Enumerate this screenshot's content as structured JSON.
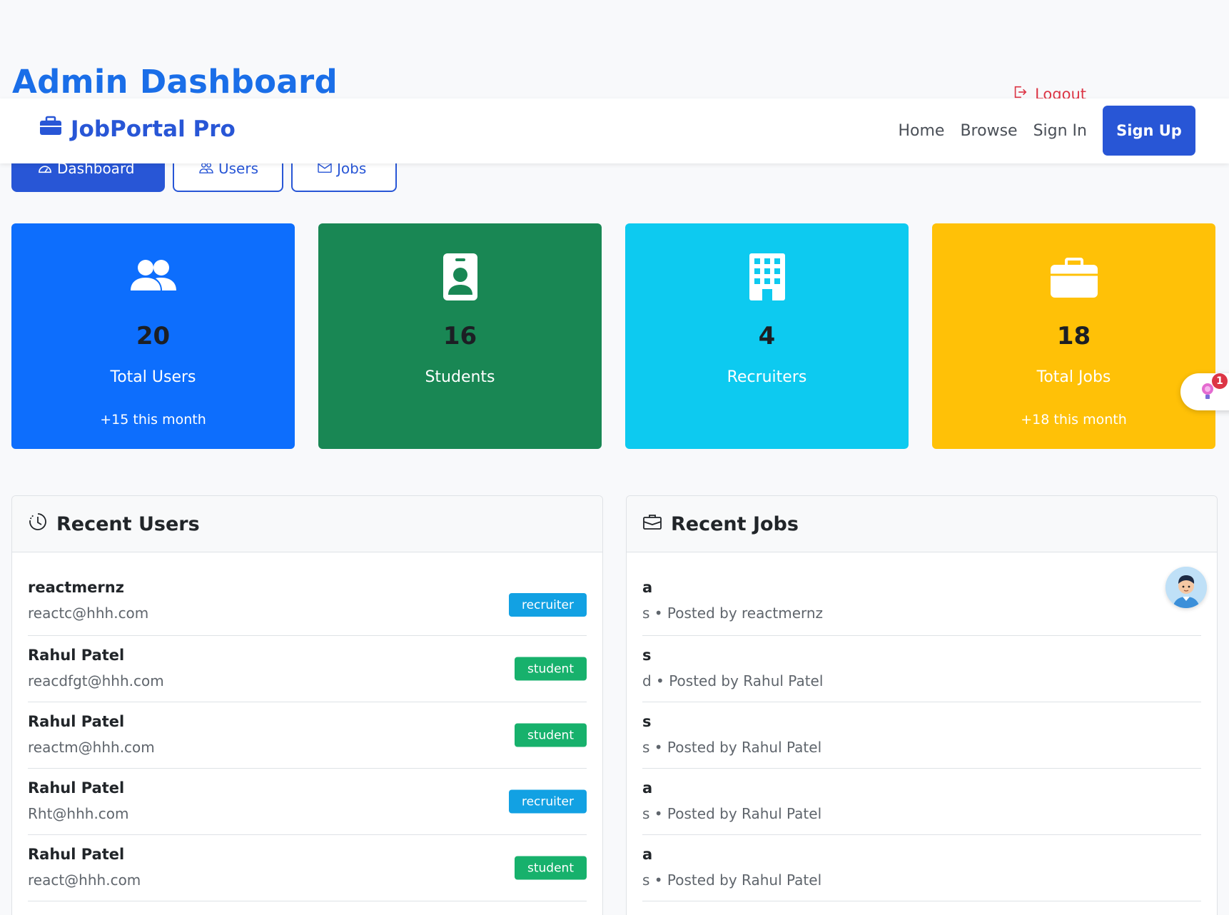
{
  "page": {
    "title": "Admin Dashboard",
    "logout_label": "Logout"
  },
  "tabs": [
    {
      "label": "Dashboard",
      "icon": "speedometer-icon",
      "active": true
    },
    {
      "label": "Users",
      "icon": "people-icon",
      "active": false
    },
    {
      "label": "Jobs",
      "icon": "envelope-icon",
      "active": false
    }
  ],
  "navbar": {
    "brand": "JobPortal Pro",
    "brand_icon": "briefcase-icon",
    "links": [
      "Home",
      "Browse",
      "Sign In"
    ],
    "signup_label": "Sign Up"
  },
  "stats": [
    {
      "value": "20",
      "label": "Total Users",
      "sub": "+15 this month",
      "color": "#0d6efd",
      "icon": "people-fill-icon"
    },
    {
      "value": "16",
      "label": "Students",
      "sub": "",
      "color": "#198754",
      "icon": "person-badge-icon"
    },
    {
      "value": "4",
      "label": "Recruiters",
      "sub": "",
      "color": "#0dcaf0",
      "icon": "building-icon"
    },
    {
      "value": "18",
      "label": "Total Jobs",
      "sub": "+18 this month",
      "color": "#ffc107",
      "icon": "briefcase-fill-icon"
    }
  ],
  "notification": {
    "count": "1",
    "icon": "lightbulb-icon"
  },
  "recent_users": {
    "title": "Recent Users",
    "icon": "clock-history-icon",
    "rows": [
      {
        "name": "reactmernz",
        "email": "reactc@hhh.com",
        "role": "recruiter"
      },
      {
        "name": "Rahul Patel",
        "email": "reacdfgt@hhh.com",
        "role": "student"
      },
      {
        "name": "Rahul Patel",
        "email": "reactm@hhh.com",
        "role": "student"
      },
      {
        "name": "Rahul Patel",
        "email": "Rht@hhh.com",
        "role": "recruiter"
      },
      {
        "name": "Rahul Patel",
        "email": "react@hhh.com",
        "role": "student"
      }
    ]
  },
  "recent_jobs": {
    "title": "Recent Jobs",
    "icon": "briefcase-outline-icon",
    "rows": [
      {
        "title": "a",
        "meta": "s • Posted by reactmernz"
      },
      {
        "title": "s",
        "meta": "d • Posted by Rahul Patel"
      },
      {
        "title": "s",
        "meta": "s • Posted by Rahul Patel"
      },
      {
        "title": "a",
        "meta": "s • Posted by Rahul Patel"
      },
      {
        "title": "a",
        "meta": "s • Posted by Rahul Patel"
      }
    ]
  },
  "colors": {
    "primary": "#2856d6",
    "title_blue": "#1a6ee8",
    "danger": "#dc3545"
  }
}
